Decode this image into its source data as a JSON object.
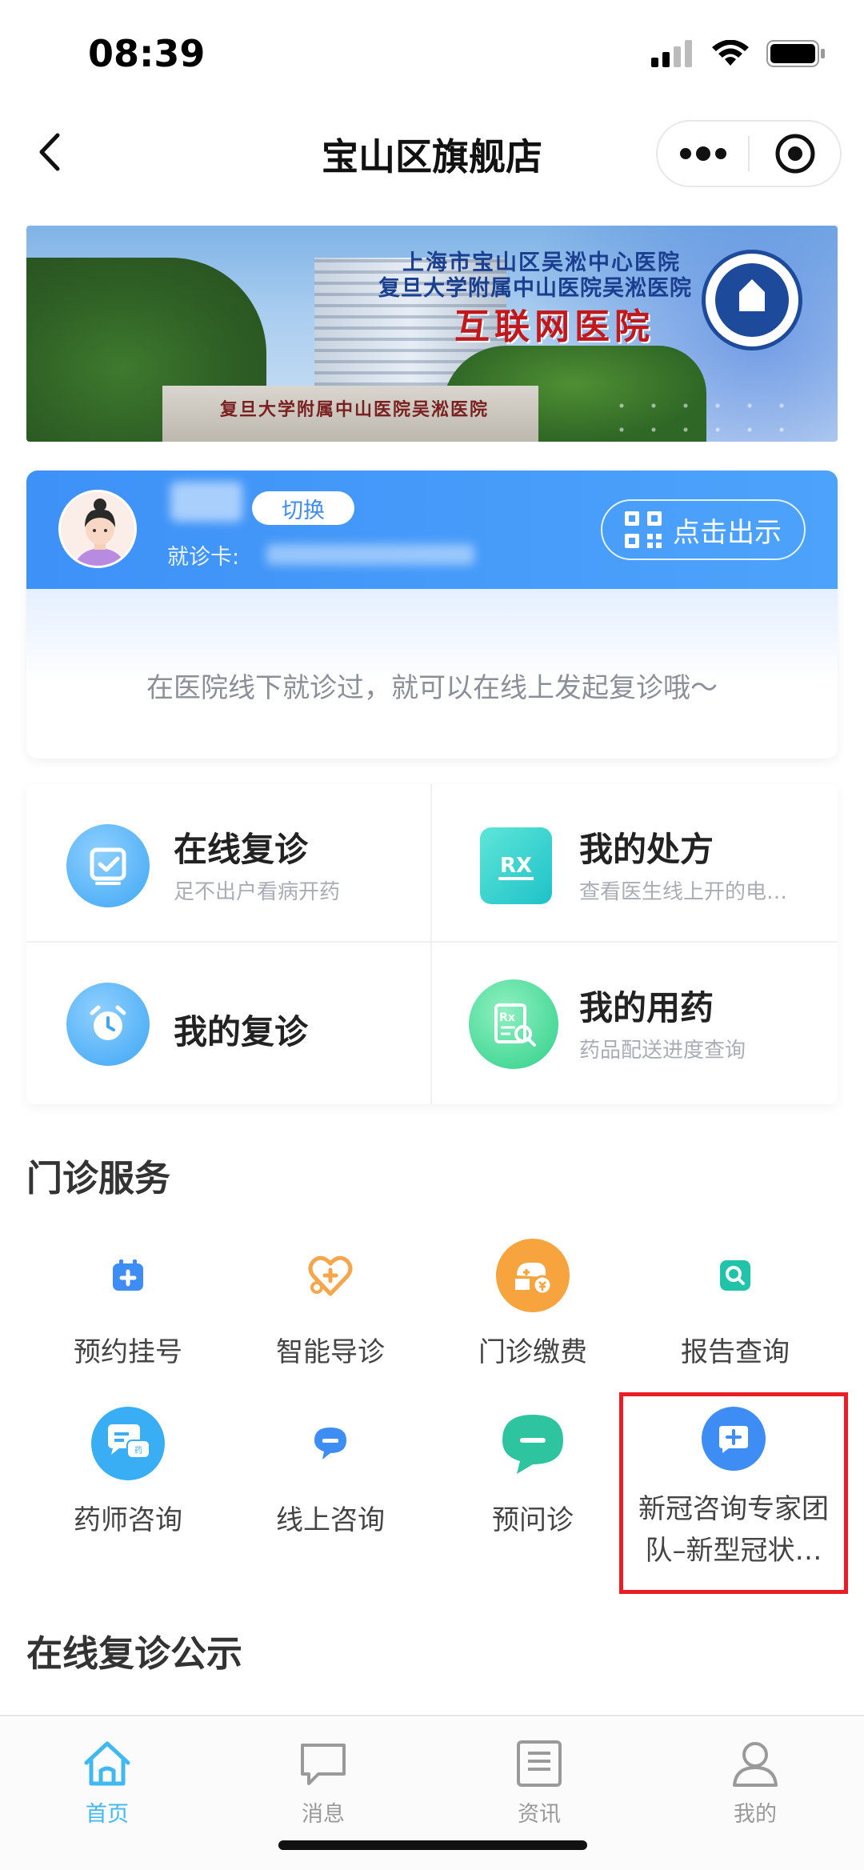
{
  "status_bar": {
    "time": "08:39"
  },
  "nav": {
    "title": "宝山区旗舰店"
  },
  "banner": {
    "line1": "上海市宝山区吴淞中心医院",
    "line2": "复旦大学附属中山医院吴淞医院",
    "line3": "互联网医院",
    "gate_text": "复旦大学附属中山医院吴淞医院"
  },
  "patient_card": {
    "switch_label": "切换",
    "card_label": "就诊卡:",
    "show_button": "点击出示",
    "hint": "在医院线下就诊过，就可以在线上发起复诊哦～"
  },
  "quick_grid": [
    {
      "title": "在线复诊",
      "subtitle": "足不出户看病开药"
    },
    {
      "title": "我的处方",
      "subtitle": "查看医生线上开的电…"
    },
    {
      "title": "我的复诊",
      "subtitle": ""
    },
    {
      "title": "我的用药",
      "subtitle": "药品配送进度查询"
    }
  ],
  "outpatient": {
    "title": "门诊服务",
    "items": [
      {
        "label": "预约挂号",
        "icon": "calendar-plus-icon",
        "color": "#3d8df5"
      },
      {
        "label": "智能导诊",
        "icon": "heart-stethoscope-icon",
        "color": "#f5a54a"
      },
      {
        "label": "门诊缴费",
        "icon": "payment-icon",
        "color": "#f5a54a"
      },
      {
        "label": "报告查询",
        "icon": "report-search-icon",
        "color": "#21c4a8"
      },
      {
        "label": "药师咨询",
        "icon": "pharmacist-chat-icon",
        "color": "#3aaef5"
      },
      {
        "label": "线上咨询",
        "icon": "chat-bubble-icon",
        "color": "#3d8df5"
      },
      {
        "label": "预问诊",
        "icon": "pre-consult-icon",
        "color": "#2ec4a0"
      },
      {
        "label_line1": "新冠咨询专家团",
        "label_line2": "队–新型冠状…",
        "icon": "medical-chat-icon",
        "color": "#3d8df5"
      }
    ]
  },
  "notice": {
    "title": "在线复诊公示"
  },
  "tabs": [
    {
      "label": "首页",
      "active": true
    },
    {
      "label": "消息",
      "active": false
    },
    {
      "label": "资讯",
      "active": false
    },
    {
      "label": "我的",
      "active": false
    }
  ]
}
